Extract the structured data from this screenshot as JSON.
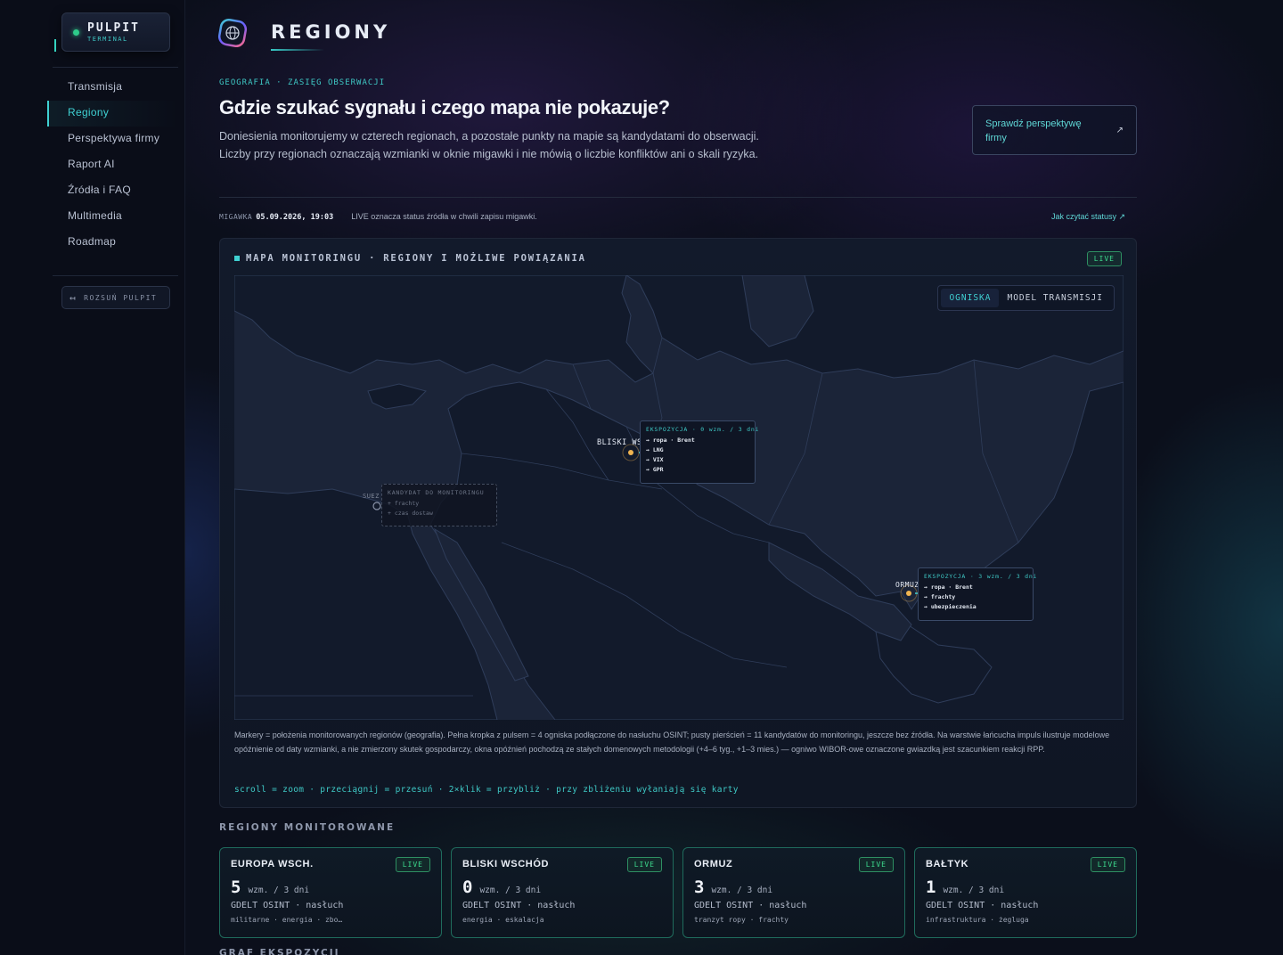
{
  "sidebar": {
    "brand_title": "PULPIT",
    "brand_sub": "TERMINAL",
    "items": [
      {
        "label": "Transmisja"
      },
      {
        "label": "Regiony"
      },
      {
        "label": "Perspektywa firmy"
      },
      {
        "label": "Raport AI"
      },
      {
        "label": "Źródła i FAQ"
      },
      {
        "label": "Multimedia"
      },
      {
        "label": "Roadmap"
      }
    ],
    "active_index": 1,
    "expand_label": "ROZSUŃ PULPIT"
  },
  "header": {
    "title": "REGIONY",
    "kicker": "GEOGRAFIA · ZASIĘG OBSERWACJI",
    "headline": "Gdzie szukać sygnału i czego mapa nie pokazuje?",
    "lead": "Doniesienia monitorujemy w czterech regionach, a pozostałe punkty na mapie są kandydatami do obserwacji. Liczby przy regionach oznaczają wzmianki w oknie migawki i nie mówią o liczbie konfliktów ani o skali ryzyka.",
    "cta_label": "Sprawdź perspektywę firmy",
    "cta_arrow": "↗"
  },
  "snapshot": {
    "key": "MIGAWKA",
    "value": "05.09.2026, 19:03",
    "note": "LIVE oznacza status źródła w chwili zapisu migawki.",
    "howto": "Jak czytać statusy ↗"
  },
  "map": {
    "title": "MAPA MONITORINGU · REGIONY I MOŻLIWE POWIĄZANIA",
    "live": "LIVE",
    "tabs": [
      {
        "label": "OGNISKA",
        "active": true
      },
      {
        "label": "MODEL TRANSMISJI",
        "active": false
      }
    ],
    "markers": [
      {
        "label": "BLISKI WS",
        "header": "EKSPOZYCJA · 0 wzm. / 3 dni",
        "items": [
          "ropa · Brent",
          "LNG",
          "VIX",
          "GPR"
        ]
      },
      {
        "label": "ORMUZ",
        "header": "EKSPOZYCJA · 3 wzm. / 3 dni",
        "items": [
          "ropa · Brent",
          "frachty",
          "ubezpieczenia"
        ]
      },
      {
        "label": "SUEZ",
        "header": "KANDYDAT DO MONITORINGU",
        "items": [
          "frachty",
          "czas dostaw"
        ]
      }
    ],
    "legend": "Markery = położenia monitorowanych regionów (geografia). Pełna kropka z pulsem = 4 ogniska podłączone do nasłuchu OSINT; pusty pierścień = 11 kandydatów do monitoringu, jeszcze bez źródła. Na warstwie łańcucha impuls ilustruje modelowe opóźnienie od daty wzmianki, a nie zmierzony skutek gospodarczy, okna opóźnień pochodzą ze stałych domenowych metodologii (+4–6 tyg., +1–3 mies.) — ogniwo WIBOR-owe oznaczone gwiazdką jest szacunkiem reakcji RPP.",
    "hints": "scroll = zoom · przeciągnij = przesuń · 2×klik = przybliż · przy zbliżeniu wyłaniają się karty"
  },
  "regions": {
    "title": "REGIONY MONITOROWANE",
    "cards": [
      {
        "name": "EUROPA WSCH.",
        "live": "LIVE",
        "count": "5",
        "unit": "wzm. / 3 dni",
        "source": "GDELT OSINT · nasłuch",
        "tags": "militarne · energia · zbo…"
      },
      {
        "name": "BLISKI WSCHÓD",
        "live": "LIVE",
        "count": "0",
        "unit": "wzm. / 3 dni",
        "source": "GDELT OSINT · nasłuch",
        "tags": "energia · eskalacja"
      },
      {
        "name": "ORMUZ",
        "live": "LIVE",
        "count": "3",
        "unit": "wzm. / 3 dni",
        "source": "GDELT OSINT · nasłuch",
        "tags": "tranzyt ropy · frachty"
      },
      {
        "name": "BAŁTYK",
        "live": "LIVE",
        "count": "1",
        "unit": "wzm. / 3 dni",
        "source": "GDELT OSINT · nasłuch",
        "tags": "infrastruktura · żegluga"
      }
    ],
    "next_title": "GRAF EKSPOZYCJI"
  }
}
